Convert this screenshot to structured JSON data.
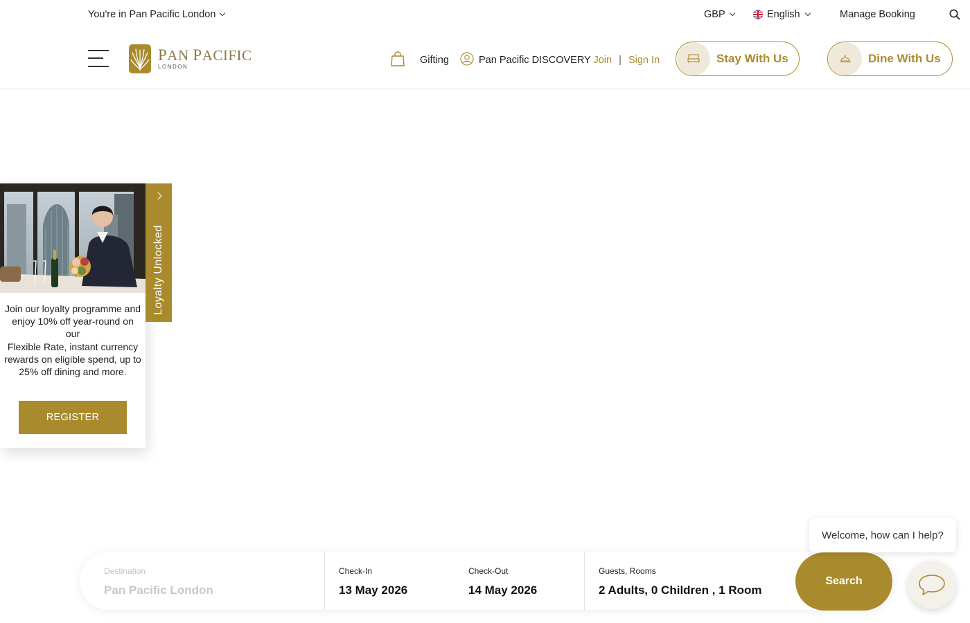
{
  "topbar": {
    "location": "You're in Pan Pacific London",
    "currency": "GBP",
    "language": "English",
    "manage_booking": "Manage Booking"
  },
  "header": {
    "logo_name_first": "P",
    "logo_name_rest": "AN ",
    "logo_name_second": "P",
    "logo_name_second_rest": "ACIFIC",
    "logo_sub": "LONDON",
    "gifting": "Gifting",
    "discovery": "Pan Pacific DISCOVERY",
    "join": "Join",
    "separator": "|",
    "sign_in": "Sign In",
    "stay": "Stay With Us",
    "dine": "Dine With Us"
  },
  "loyalty": {
    "tab_label": "Loyalty Unlocked",
    "text_line1": "Join our loyalty programme and enjoy 10% off year-round on our",
    "text_line2": "Flexible Rate, instant currency rewards on eligible spend, up to 25% off dining and more.",
    "register": "REGISTER"
  },
  "booking": {
    "destination_label": "Destination",
    "destination_value": "Pan Pacific London",
    "checkin_label": "Check-In",
    "checkin_value": "13 May 2026",
    "checkout_label": "Check-Out",
    "checkout_value": "14 May 2026",
    "guests_label": "Guests, Rooms",
    "guests_value": "2 Adults, 0 Children , 1 Room",
    "search": "Search"
  },
  "chat": {
    "prompt": "Welcome, how can I help?"
  },
  "colors": {
    "accent_gold": "#a98b2e",
    "pill_circle": "#efe9dc"
  },
  "icons": [
    "chevron-down-icon",
    "uk-flag-icon",
    "search-icon",
    "menu-icon",
    "shopping-bag-icon",
    "user-icon",
    "bed-icon",
    "cloche-icon",
    "chevron-right-icon",
    "chat-icon"
  ]
}
